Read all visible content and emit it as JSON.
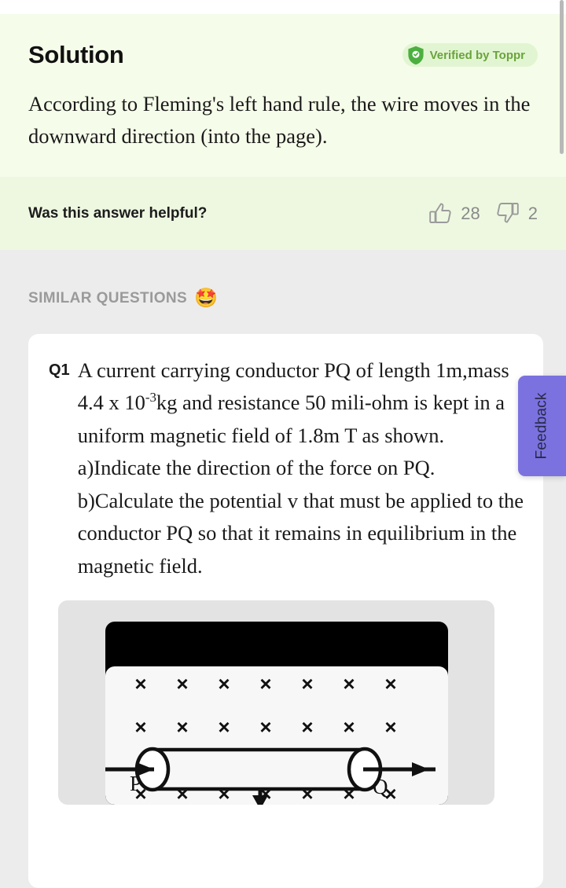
{
  "solution": {
    "title": "Solution",
    "verified_badge": {
      "label": "Verified by Toppr",
      "icon": "shield-check-icon",
      "text_color": "#6aa33c",
      "bg_color": "#e2f5d2"
    },
    "body": "According to Fleming's left hand rule, the wire moves in the downward direction (into the page)."
  },
  "helpful": {
    "prompt": "Was this answer helpful?",
    "upvote": {
      "icon": "thumbs-up-icon",
      "count": "28"
    },
    "downvote": {
      "icon": "thumbs-down-icon",
      "count": "2"
    }
  },
  "similar_questions": {
    "heading": "SIMILAR QUESTIONS",
    "emoji": "🤩",
    "items": [
      {
        "label": "Q1",
        "text_part1": "A current carrying conductor PQ of length 1m,mass 4.4 x 10",
        "exponent": "-3",
        "text_part2": "kg and resistance 50 mili-ohm is kept in a uniform magnetic field of 1.8m T as shown.",
        "text_part3": "a)Indicate the direction of the force on PQ.",
        "text_part4": "b)Calculate the potential v that must be applied to the conductor PQ so that it remains in equilibrium in the magnetic field.",
        "diagram": {
          "name": "conductor-pq-magnetic-field-diagram",
          "label_left": "P",
          "label_right": "Q",
          "field_symbol": "×",
          "field_rows": 3,
          "field_cols": 7,
          "field_direction": "into-page",
          "force_direction": "downward",
          "current_direction": "left-to-right"
        }
      }
    ]
  },
  "feedback_tab": {
    "label": "Feedback",
    "color": "#7b72e0"
  },
  "scrollbar": {
    "name": "vertical-scrollbar"
  },
  "colors": {
    "solution_bg": "#f5fce9",
    "helpful_bg": "#eef8e1",
    "page_bg": "#ececec",
    "card_bg": "#ffffff"
  }
}
